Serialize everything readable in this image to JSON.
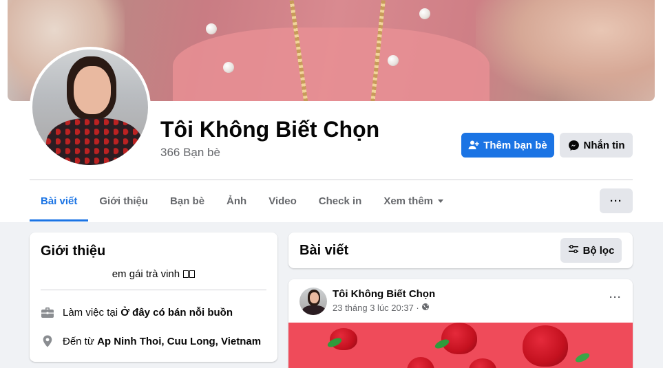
{
  "profile": {
    "name": "Tôi Không Biết Chọn",
    "friends": "366 Bạn bè",
    "add_friend": "Thêm bạn bè",
    "message": "Nhắn tin"
  },
  "tabs": [
    "Bài viết",
    "Giới thiệu",
    "Bạn bè",
    "Ảnh",
    "Video",
    "Check in",
    "Xem thêm"
  ],
  "more": "···",
  "intro": {
    "title": "Giới thiệu",
    "bio": "em gái trà vinh ",
    "work_prefix": "Làm việc tại ",
    "work_place": "Ở đây có bán nỗi buồn",
    "from_prefix": "Đến từ ",
    "from_place": "Ap Ninh Thoi, Cuu Long, Vietnam"
  },
  "posts": {
    "title": "Bài viết",
    "filter": "Bộ lọc"
  },
  "post": {
    "author": "Tôi Không Biết Chọn",
    "time": "23 tháng 3 lúc 20:37 · ",
    "menu": "···"
  },
  "colors": {
    "primary": "#1b74e4",
    "secondary_btn": "#e4e6eb",
    "background": "#f0f2f5"
  }
}
